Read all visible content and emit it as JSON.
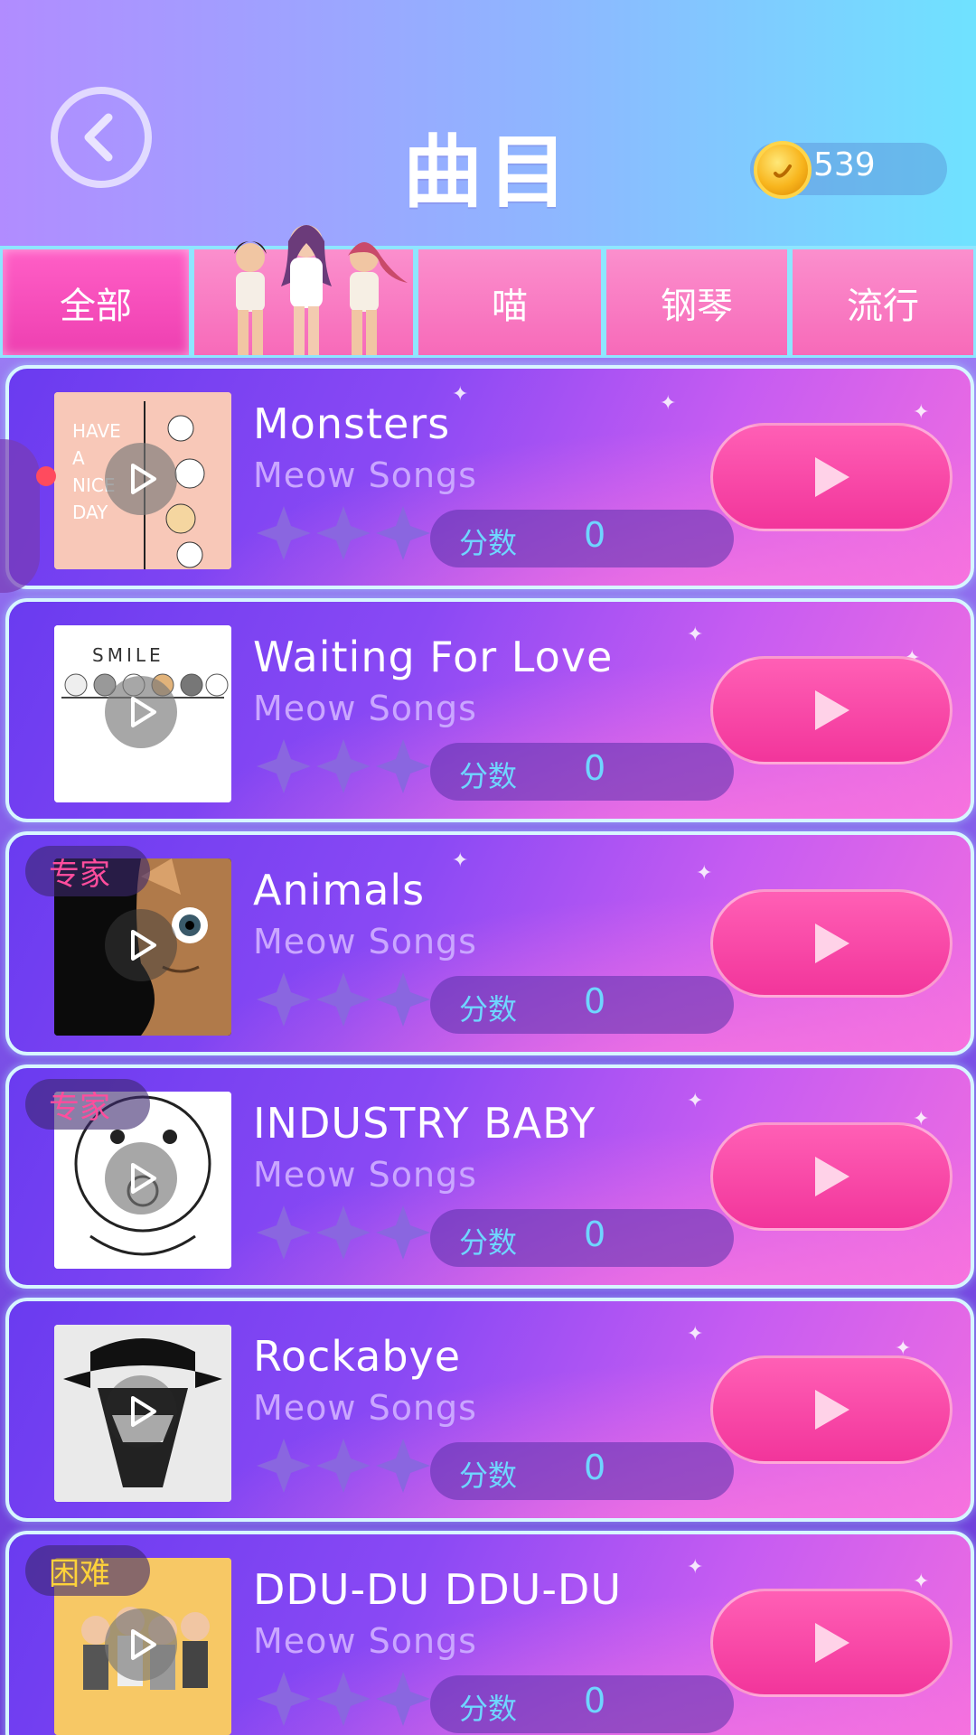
{
  "header": {
    "title": "曲目",
    "coins": "539"
  },
  "tabs": [
    {
      "label": "全部",
      "active": true
    },
    {
      "label": "",
      "active": false
    },
    {
      "label": "喵",
      "active": false
    },
    {
      "label": "钢琴",
      "active": false
    },
    {
      "label": "流行",
      "active": false
    }
  ],
  "songs": [
    {
      "title": "Monsters",
      "artist": "Meow Songs",
      "score_label": "分数",
      "score": "0",
      "badge": "",
      "cover": "have-a-nice-day"
    },
    {
      "title": "Waiting For Love",
      "artist": "Meow Songs",
      "score_label": "分数",
      "score": "0",
      "badge": "",
      "cover": "smile-cats"
    },
    {
      "title": "Animals",
      "artist": "Meow Songs",
      "score_label": "分数",
      "score": "0",
      "badge": "专家",
      "cover": "cat-face"
    },
    {
      "title": "INDUSTRY BABY",
      "artist": "Meow Songs",
      "score_label": "分数",
      "score": "0",
      "badge": "专家",
      "cover": "baby-drawing"
    },
    {
      "title": "Rockabye",
      "artist": "Meow Songs",
      "score_label": "分数",
      "score": "0",
      "badge": "",
      "cover": "hat-man"
    },
    {
      "title": "DDU-DU DDU-DU",
      "artist": "Meow Songs",
      "score_label": "分数",
      "score": "0",
      "badge": "困难",
      "cover": "girls-cartoon"
    }
  ],
  "colors": {
    "accent_pink": "#f2359b",
    "score_blue": "#6fd6ff",
    "badge_expert": "#ff4d9d",
    "badge_hard": "#ffd33a"
  }
}
